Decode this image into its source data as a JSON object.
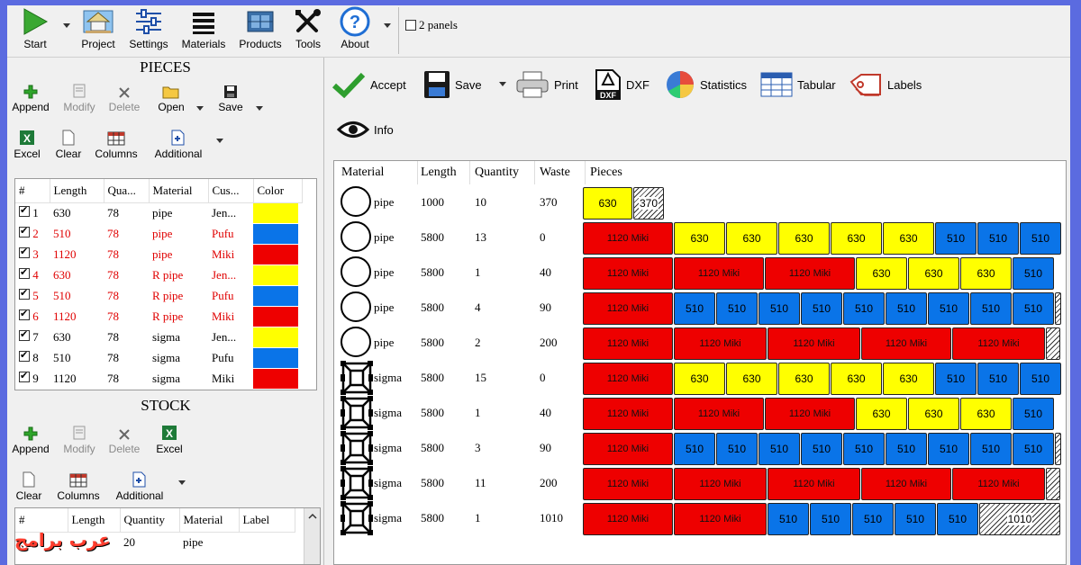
{
  "toolbar": {
    "start": "Start",
    "project": "Project",
    "settings": "Settings",
    "materials": "Materials",
    "products": "Products",
    "tools": "Tools",
    "about": "About",
    "two_panels": "2 panels"
  },
  "pieces": {
    "title": "PIECES",
    "buttons": {
      "append": "Append",
      "modify": "Modify",
      "delete": "Delete",
      "open": "Open",
      "save": "Save",
      "excel": "Excel",
      "clear": "Clear",
      "columns": "Columns",
      "additional": "Additional"
    },
    "headers": [
      "#",
      "Length",
      "Qua...",
      "Material",
      "Cus...",
      "Color"
    ],
    "rows": [
      {
        "n": "1",
        "length": "630",
        "qty": "78",
        "material": "pipe",
        "customer": "Jen...",
        "color": "#ffff00",
        "red": false
      },
      {
        "n": "2",
        "length": "510",
        "qty": "78",
        "material": "pipe",
        "customer": "Pufu",
        "color": "#0a74e8",
        "red": true
      },
      {
        "n": "3",
        "length": "1120",
        "qty": "78",
        "material": "pipe",
        "customer": "Miki",
        "color": "#ee0000",
        "red": true
      },
      {
        "n": "4",
        "length": "630",
        "qty": "78",
        "material": "R pipe",
        "customer": "Jen...",
        "color": "#ffff00",
        "red": true
      },
      {
        "n": "5",
        "length": "510",
        "qty": "78",
        "material": "R pipe",
        "customer": "Pufu",
        "color": "#0a74e8",
        "red": true
      },
      {
        "n": "6",
        "length": "1120",
        "qty": "78",
        "material": "R pipe",
        "customer": "Miki",
        "color": "#ee0000",
        "red": true
      },
      {
        "n": "7",
        "length": "630",
        "qty": "78",
        "material": "sigma",
        "customer": "Jen...",
        "color": "#ffff00",
        "red": false
      },
      {
        "n": "8",
        "length": "510",
        "qty": "78",
        "material": "sigma",
        "customer": "Pufu",
        "color": "#0a74e8",
        "red": false
      },
      {
        "n": "9",
        "length": "1120",
        "qty": "78",
        "material": "sigma",
        "customer": "Miki",
        "color": "#ee0000",
        "red": false
      }
    ]
  },
  "stock": {
    "title": "STOCK",
    "buttons": {
      "append": "Append",
      "modify": "Modify",
      "delete": "Delete",
      "excel": "Excel",
      "clear": "Clear",
      "columns": "Columns",
      "additional": "Additional"
    },
    "headers": [
      "#",
      "Length",
      "Quantity",
      "Material",
      "Label"
    ],
    "rows": [
      {
        "n": "",
        "length": "",
        "qty": "20",
        "material": "pipe",
        "label": ""
      }
    ]
  },
  "result_toolbar": {
    "accept": "Accept",
    "save": "Save",
    "print": "Print",
    "dxf": "DXF",
    "statistics": "Statistics",
    "tabular": "Tabular",
    "labels": "Labels",
    "info": "Info"
  },
  "result": {
    "headers": [
      "Material",
      "Length",
      "Quantity",
      "Waste",
      "Pieces"
    ],
    "rows": [
      {
        "material": "pipe",
        "length": "1000",
        "quantity": "10",
        "waste": "370",
        "pieces": [
          {
            "t": "Y",
            "l": "630",
            "w": 55
          },
          {
            "t": "W",
            "l": "370",
            "w": 34
          }
        ]
      },
      {
        "material": "pipe",
        "length": "5800",
        "quantity": "13",
        "waste": "0",
        "pieces": [
          {
            "t": "R",
            "l": "1120 Miki",
            "w": 100
          },
          {
            "t": "Y",
            "l": "630",
            "w": 57
          },
          {
            "t": "Y",
            "l": "630",
            "w": 57
          },
          {
            "t": "Y",
            "l": "630",
            "w": 57
          },
          {
            "t": "Y",
            "l": "630",
            "w": 57
          },
          {
            "t": "Y",
            "l": "630",
            "w": 57
          },
          {
            "t": "B",
            "l": "510",
            "w": 46
          },
          {
            "t": "B",
            "l": "510",
            "w": 46
          },
          {
            "t": "B",
            "l": "510",
            "w": 46
          }
        ]
      },
      {
        "material": "pipe",
        "length": "5800",
        "quantity": "1",
        "waste": "40",
        "pieces": [
          {
            "t": "R",
            "l": "1120 Miki",
            "w": 100
          },
          {
            "t": "R",
            "l": "1120 Miki",
            "w": 100
          },
          {
            "t": "R",
            "l": "1120 Miki",
            "w": 100
          },
          {
            "t": "Y",
            "l": "630",
            "w": 57
          },
          {
            "t": "Y",
            "l": "630",
            "w": 57
          },
          {
            "t": "Y",
            "l": "630",
            "w": 57
          },
          {
            "t": "B",
            "l": "510",
            "w": 46
          }
        ]
      },
      {
        "material": "pipe",
        "length": "5800",
        "quantity": "4",
        "waste": "90",
        "pieces": [
          {
            "t": "R",
            "l": "1120 Miki",
            "w": 100
          },
          {
            "t": "B",
            "l": "510",
            "w": 46
          },
          {
            "t": "B",
            "l": "510",
            "w": 46
          },
          {
            "t": "B",
            "l": "510",
            "w": 46
          },
          {
            "t": "B",
            "l": "510",
            "w": 46
          },
          {
            "t": "B",
            "l": "510",
            "w": 46
          },
          {
            "t": "B",
            "l": "510",
            "w": 46
          },
          {
            "t": "B",
            "l": "510",
            "w": 46
          },
          {
            "t": "B",
            "l": "510",
            "w": 46
          },
          {
            "t": "B",
            "l": "510",
            "w": 46
          },
          {
            "t": "W",
            "l": "",
            "w": 7
          }
        ]
      },
      {
        "material": "pipe",
        "length": "5800",
        "quantity": "2",
        "waste": "200",
        "pieces": [
          {
            "t": "R",
            "l": "1120 Miki",
            "w": 100
          },
          {
            "t": "R",
            "l": "1120 Miki",
            "w": 103
          },
          {
            "t": "R",
            "l": "1120 Miki",
            "w": 103
          },
          {
            "t": "R",
            "l": "1120 Miki",
            "w": 100
          },
          {
            "t": "R",
            "l": "1120 Miki",
            "w": 103
          },
          {
            "t": "W",
            "l": "",
            "w": 16
          }
        ]
      },
      {
        "material": "sigma",
        "length": "5800",
        "quantity": "15",
        "waste": "0",
        "pieces": [
          {
            "t": "R",
            "l": "1120 Miki",
            "w": 100
          },
          {
            "t": "Y",
            "l": "630",
            "w": 57
          },
          {
            "t": "Y",
            "l": "630",
            "w": 57
          },
          {
            "t": "Y",
            "l": "630",
            "w": 57
          },
          {
            "t": "Y",
            "l": "630",
            "w": 57
          },
          {
            "t": "Y",
            "l": "630",
            "w": 57
          },
          {
            "t": "B",
            "l": "510",
            "w": 46
          },
          {
            "t": "B",
            "l": "510",
            "w": 46
          },
          {
            "t": "B",
            "l": "510",
            "w": 46
          }
        ]
      },
      {
        "material": "sigma",
        "length": "5800",
        "quantity": "1",
        "waste": "40",
        "pieces": [
          {
            "t": "R",
            "l": "1120 Miki",
            "w": 100
          },
          {
            "t": "R",
            "l": "1120 Miki",
            "w": 100
          },
          {
            "t": "R",
            "l": "1120 Miki",
            "w": 100
          },
          {
            "t": "Y",
            "l": "630",
            "w": 57
          },
          {
            "t": "Y",
            "l": "630",
            "w": 57
          },
          {
            "t": "Y",
            "l": "630",
            "w": 57
          },
          {
            "t": "B",
            "l": "510",
            "w": 46
          }
        ]
      },
      {
        "material": "sigma",
        "length": "5800",
        "quantity": "3",
        "waste": "90",
        "pieces": [
          {
            "t": "R",
            "l": "1120 Miki",
            "w": 100
          },
          {
            "t": "B",
            "l": "510",
            "w": 46
          },
          {
            "t": "B",
            "l": "510",
            "w": 46
          },
          {
            "t": "B",
            "l": "510",
            "w": 46
          },
          {
            "t": "B",
            "l": "510",
            "w": 46
          },
          {
            "t": "B",
            "l": "510",
            "w": 46
          },
          {
            "t": "B",
            "l": "510",
            "w": 46
          },
          {
            "t": "B",
            "l": "510",
            "w": 46
          },
          {
            "t": "B",
            "l": "510",
            "w": 46
          },
          {
            "t": "B",
            "l": "510",
            "w": 46
          },
          {
            "t": "W",
            "l": "",
            "w": 7
          }
        ]
      },
      {
        "material": "sigma",
        "length": "5800",
        "quantity": "11",
        "waste": "200",
        "pieces": [
          {
            "t": "R",
            "l": "1120 Miki",
            "w": 100
          },
          {
            "t": "R",
            "l": "1120 Miki",
            "w": 103
          },
          {
            "t": "R",
            "l": "1120 Miki",
            "w": 103
          },
          {
            "t": "R",
            "l": "1120 Miki",
            "w": 100
          },
          {
            "t": "R",
            "l": "1120 Miki",
            "w": 103
          },
          {
            "t": "W",
            "l": "",
            "w": 16
          }
        ]
      },
      {
        "material": "sigma",
        "length": "5800",
        "quantity": "1",
        "waste": "1010",
        "pieces": [
          {
            "t": "R",
            "l": "1120 Miki",
            "w": 100
          },
          {
            "t": "R",
            "l": "1120 Miki",
            "w": 103
          },
          {
            "t": "B",
            "l": "510",
            "w": 46
          },
          {
            "t": "B",
            "l": "510",
            "w": 46
          },
          {
            "t": "B",
            "l": "510",
            "w": 46
          },
          {
            "t": "B",
            "l": "510",
            "w": 46
          },
          {
            "t": "B",
            "l": "510",
            "w": 46
          },
          {
            "t": "W",
            "l": "1010",
            "w": 90
          }
        ]
      }
    ]
  },
  "watermark": "عرب برامج"
}
